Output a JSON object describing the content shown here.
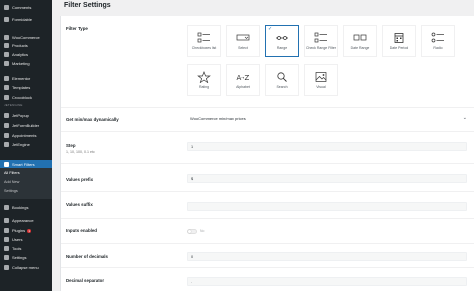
{
  "sidebar": {
    "items": [
      {
        "label": "Comments",
        "icon": "comments-icon"
      },
      {
        "label": "Formidable",
        "icon": "formidable-icon"
      },
      {
        "label": "WooCommerce",
        "icon": "woocommerce-icon"
      },
      {
        "label": "Products",
        "icon": "products-icon"
      },
      {
        "label": "Analytics",
        "icon": "analytics-icon"
      },
      {
        "label": "Marketing",
        "icon": "marketing-icon"
      },
      {
        "label": "Elementor",
        "icon": "elementor-icon"
      },
      {
        "label": "Templates",
        "icon": "templates-icon"
      },
      {
        "label": "Crocoblock",
        "icon": "crocoblock-icon"
      },
      {
        "label": "JetPopup",
        "icon": "jetpopup-icon"
      },
      {
        "label": "JetFormBuilder",
        "icon": "jetformbuilder-icon"
      },
      {
        "label": "Appointments",
        "icon": "appointments-icon"
      },
      {
        "label": "JetEngine",
        "icon": "jetengine-icon"
      },
      {
        "label": "Smart Filters",
        "icon": "smart-filters-icon"
      },
      {
        "label": "Bookings",
        "icon": "bookings-icon"
      },
      {
        "label": "Appearance",
        "icon": "appearance-icon"
      },
      {
        "label": "Plugins",
        "icon": "plugins-icon",
        "badge": "1"
      },
      {
        "label": "Users",
        "icon": "users-icon"
      },
      {
        "label": "Tools",
        "icon": "tools-icon"
      },
      {
        "label": "Settings",
        "icon": "settings-icon"
      },
      {
        "label": "Collapse menu",
        "icon": "collapse-icon"
      }
    ],
    "section_label": "JETENGINE",
    "submenu": [
      "All Filters",
      "Add New",
      "Settings"
    ]
  },
  "page": {
    "title": "Filter Settings"
  },
  "filter_type": {
    "label": "Filter Type",
    "tiles": [
      {
        "label": "Checkboxes list",
        "icon": "checkboxes-list-icon"
      },
      {
        "label": "Select",
        "icon": "select-icon"
      },
      {
        "label": "Range",
        "icon": "range-icon",
        "selected": true
      },
      {
        "label": "Check Range Filter",
        "icon": "check-range-icon"
      },
      {
        "label": "Date Range",
        "icon": "date-range-icon"
      },
      {
        "label": "Date Period",
        "icon": "date-period-icon"
      },
      {
        "label": "Radio",
        "icon": "radio-icon"
      },
      {
        "label": "Rating",
        "icon": "rating-icon"
      },
      {
        "label": "Alphabet",
        "icon": "alphabet-icon"
      },
      {
        "label": "Search",
        "icon": "search-icon"
      },
      {
        "label": "Visual",
        "icon": "visual-icon"
      }
    ]
  },
  "fields": {
    "minmax": {
      "label": "Get min/max dynamically",
      "value": "WooCommerce min/max prices"
    },
    "step": {
      "label": "Step",
      "desc": "1, 10, 100, 0.1 etc",
      "value": "1"
    },
    "prefix": {
      "label": "Values prefix",
      "value": "$"
    },
    "suffix": {
      "label": "Values suffix",
      "value": ""
    },
    "inputs": {
      "label": "Inputs enabled",
      "toggle_text": "No"
    },
    "decimals": {
      "label": "Number of decimals",
      "value": "0"
    },
    "decimal_sep": {
      "label": "Decimal separator",
      "value": "."
    }
  },
  "colors": {
    "sidebar_bg": "#1d2327",
    "active": "#2271b1",
    "page_bg": "#f0f0f1"
  }
}
